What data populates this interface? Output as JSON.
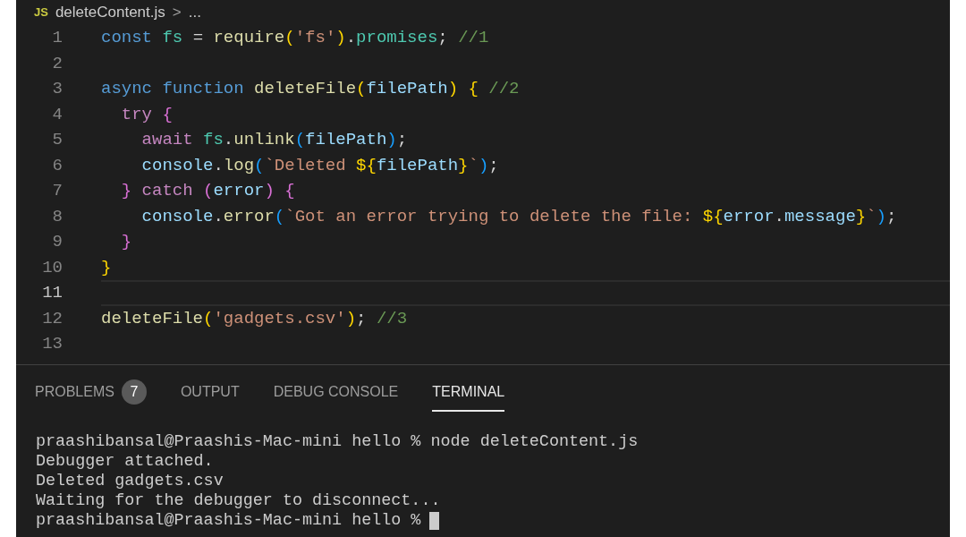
{
  "breadcrumb": {
    "file_icon": "JS",
    "file": "deleteContent.js",
    "separator": ">",
    "rest": "..."
  },
  "editor": {
    "lines": [
      {
        "number": "1",
        "active": false,
        "tokens": [
          {
            "t": "const ",
            "kind": "keyword"
          },
          {
            "t": "fs",
            "kind": "type"
          },
          {
            "t": " = ",
            "kind": "plain"
          },
          {
            "t": "require",
            "kind": "function"
          },
          {
            "t": "(",
            "kind": "bracket1"
          },
          {
            "t": "'fs'",
            "kind": "string"
          },
          {
            "t": ")",
            "kind": "bracket1"
          },
          {
            "t": ".",
            "kind": "plain"
          },
          {
            "t": "promises",
            "kind": "type"
          },
          {
            "t": ";",
            "kind": "plain"
          },
          {
            "t": " //1",
            "kind": "comment"
          }
        ]
      },
      {
        "number": "2",
        "active": false
      },
      {
        "number": "3",
        "active": false,
        "tokens": [
          {
            "t": "async function ",
            "kind": "keyword"
          },
          {
            "t": "deleteFile",
            "kind": "function"
          },
          {
            "t": "(",
            "kind": "bracket1"
          },
          {
            "t": "filePath",
            "kind": "variable"
          },
          {
            "t": ")",
            "kind": "bracket1"
          },
          {
            "t": " {",
            "kind": "bracket1"
          },
          {
            "t": " //2",
            "kind": "comment"
          }
        ]
      },
      {
        "number": "4",
        "active": false,
        "tokens": [
          {
            "t": "  try",
            "kind": "control"
          },
          {
            "t": " {",
            "kind": "bracket2"
          }
        ]
      },
      {
        "number": "5",
        "active": false,
        "tokens": [
          {
            "t": "    await",
            "kind": "control"
          },
          {
            "t": " fs",
            "kind": "type"
          },
          {
            "t": ".",
            "kind": "plain"
          },
          {
            "t": "unlink",
            "kind": "function"
          },
          {
            "t": "(",
            "kind": "bracket3"
          },
          {
            "t": "filePath",
            "kind": "variable"
          },
          {
            "t": ")",
            "kind": "bracket3"
          },
          {
            "t": ";",
            "kind": "plain"
          }
        ]
      },
      {
        "number": "6",
        "active": false,
        "tokens": [
          {
            "t": "    console",
            "kind": "variable"
          },
          {
            "t": ".",
            "kind": "plain"
          },
          {
            "t": "log",
            "kind": "function"
          },
          {
            "t": "(",
            "kind": "bracket3"
          },
          {
            "t": "`Deleted ",
            "kind": "string"
          },
          {
            "t": "${",
            "kind": "template"
          },
          {
            "t": "filePath",
            "kind": "variable"
          },
          {
            "t": "}",
            "kind": "template"
          },
          {
            "t": "`",
            "kind": "string"
          },
          {
            "t": ")",
            "kind": "bracket3"
          },
          {
            "t": ";",
            "kind": "plain"
          }
        ]
      },
      {
        "number": "7",
        "active": false,
        "tokens": [
          {
            "t": "  }",
            "kind": "bracket2"
          },
          {
            "t": " catch",
            "kind": "control"
          },
          {
            "t": " (",
            "kind": "bracket2"
          },
          {
            "t": "error",
            "kind": "variable"
          },
          {
            "t": ")",
            "kind": "bracket2"
          },
          {
            "t": " {",
            "kind": "bracket2"
          }
        ]
      },
      {
        "number": "8",
        "active": false,
        "tokens": [
          {
            "t": "    console",
            "kind": "variable"
          },
          {
            "t": ".",
            "kind": "plain"
          },
          {
            "t": "error",
            "kind": "function"
          },
          {
            "t": "(",
            "kind": "bracket3"
          },
          {
            "t": "`Got an error trying to delete the file: ",
            "kind": "string"
          },
          {
            "t": "${",
            "kind": "template"
          },
          {
            "t": "error",
            "kind": "variable"
          },
          {
            "t": ".",
            "kind": "plain"
          },
          {
            "t": "message",
            "kind": "variable"
          },
          {
            "t": "}",
            "kind": "template"
          },
          {
            "t": "`",
            "kind": "string"
          },
          {
            "t": ")",
            "kind": "bracket3"
          },
          {
            "t": ";",
            "kind": "plain"
          }
        ]
      },
      {
        "number": "9",
        "active": false,
        "tokens": [
          {
            "t": "  }",
            "kind": "bracket2"
          }
        ]
      },
      {
        "number": "10",
        "active": false,
        "tokens": [
          {
            "t": "}",
            "kind": "bracket1"
          }
        ]
      },
      {
        "number": "11",
        "active": true
      },
      {
        "number": "12",
        "active": false,
        "tokens": [
          {
            "t": "deleteFile",
            "kind": "function"
          },
          {
            "t": "(",
            "kind": "bracket1"
          },
          {
            "t": "'gadgets.csv'",
            "kind": "string"
          },
          {
            "t": ")",
            "kind": "bracket1"
          },
          {
            "t": ";",
            "kind": "plain"
          },
          {
            "t": " //3",
            "kind": "comment"
          }
        ]
      },
      {
        "number": "13",
        "active": false
      }
    ]
  },
  "panel": {
    "tabs": [
      {
        "label": "PROBLEMS",
        "badge": "7",
        "selected": false
      },
      {
        "label": "OUTPUT",
        "selected": false
      },
      {
        "label": "DEBUG CONSOLE",
        "selected": false
      },
      {
        "label": "TERMINAL",
        "selected": true
      }
    ],
    "terminal": {
      "lines": [
        {
          "text": "praashibansal@Praashis-Mac-mini hello % node deleteContent.js",
          "cursor": false
        },
        {
          "text": "Debugger attached.",
          "cursor": false
        },
        {
          "text": "Deleted gadgets.csv",
          "cursor": false
        },
        {
          "text": "Waiting for the debugger to disconnect...",
          "cursor": false
        },
        {
          "text": "praashibansal@Praashis-Mac-mini hello %",
          "cursor": true
        }
      ]
    }
  }
}
